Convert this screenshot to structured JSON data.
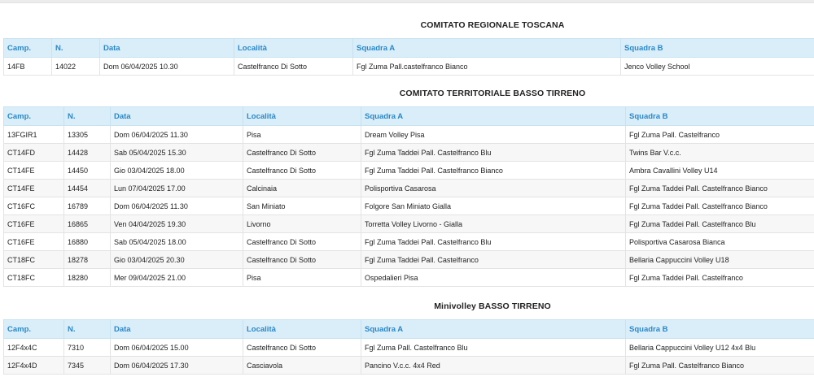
{
  "headers": [
    "Camp.",
    "N.",
    "Data",
    "Località",
    "Squadra A",
    "Squadra B"
  ],
  "sections": [
    {
      "title": "COMITATO REGIONALE TOSCANA",
      "rows": [
        [
          "14FB",
          "14022",
          "Dom 06/04/2025 10.30",
          "Castelfranco Di Sotto",
          "Fgl Zuma Pall.castelfranco Bianco",
          "Jenco Volley School"
        ]
      ]
    },
    {
      "title": "COMITATO TERRITORIALE BASSO TIRRENO",
      "rows": [
        [
          "13FGIR1",
          "13305",
          "Dom 06/04/2025 11.30",
          "Pisa",
          "Dream Volley Pisa",
          "Fgl Zuma Pall. Castelfranco"
        ],
        [
          "CT14FD",
          "14428",
          "Sab 05/04/2025 15.30",
          "Castelfranco Di Sotto",
          "Fgl Zuma Taddei Pall. Castelfranco Blu",
          "Twins Bar V.c.c."
        ],
        [
          "CT14FE",
          "14450",
          "Gio 03/04/2025 18.00",
          "Castelfranco Di Sotto",
          "Fgl Zuma Taddei Pall. Castelfranco Bianco",
          "Ambra Cavallini Volley U14"
        ],
        [
          "CT14FE",
          "14454",
          "Lun 07/04/2025 17.00",
          "Calcinaia",
          "Polisportiva Casarosa",
          "Fgl Zuma Taddei Pall. Castelfranco Bianco"
        ],
        [
          "CT16FC",
          "16789",
          "Dom 06/04/2025 11.30",
          "San Miniato",
          "Folgore San Miniato Gialla",
          "Fgl Zuma Taddei Pall. Castelfranco Bianco"
        ],
        [
          "CT16FE",
          "16865",
          "Ven 04/04/2025 19.30",
          "Livorno",
          "Torretta Volley Livorno - Gialla",
          "Fgl Zuma Taddei Pall. Castelfranco Blu"
        ],
        [
          "CT16FE",
          "16880",
          "Sab 05/04/2025 18.00",
          "Castelfranco Di Sotto",
          "Fgl Zuma Taddei Pall. Castelfranco Blu",
          "Polisportiva Casarosa Bianca"
        ],
        [
          "CT18FC",
          "18278",
          "Gio 03/04/2025 20.30",
          "Castelfranco Di Sotto",
          "Fgl Zuma Taddei Pall. Castelfranco",
          "Bellaria Cappuccini Volley U18"
        ],
        [
          "CT18FC",
          "18280",
          "Mer 09/04/2025 21.00",
          "Pisa",
          "Ospedalieri Pisa",
          "Fgl Zuma Taddei Pall. Castelfranco"
        ]
      ]
    },
    {
      "title": "Minivolley BASSO TIRRENO",
      "rows": [
        [
          "12F4x4C",
          "7310",
          "Dom 06/04/2025 15.00",
          "Castelfranco Di Sotto",
          "Fgl Zuma Pall. Castelfranco Blu",
          "Bellaria Cappuccini Volley U12 4x4 Blu"
        ],
        [
          "12F4x4D",
          "7345",
          "Dom 06/04/2025 17.30",
          "Casciavola",
          "Pancino V.c.c. 4x4 Red",
          "Fgl Zuma Pall. Castelfranco Bianco"
        ]
      ]
    }
  ]
}
